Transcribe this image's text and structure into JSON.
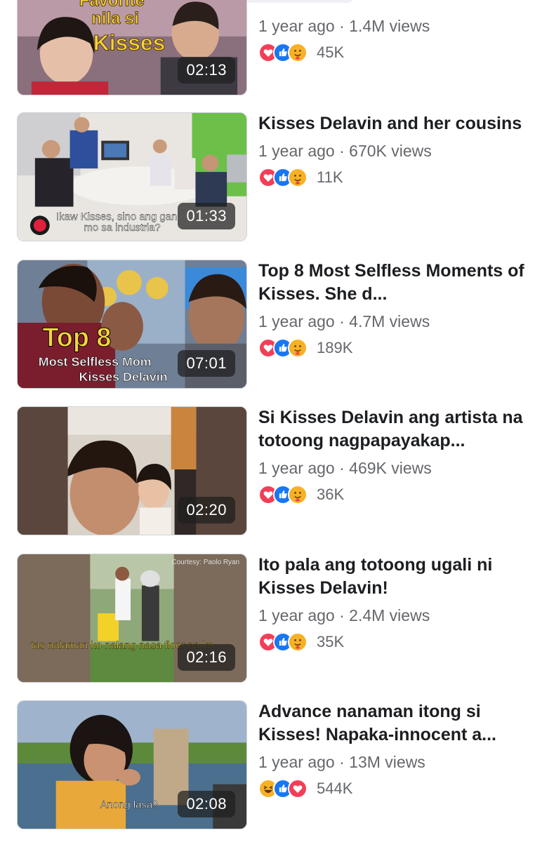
{
  "videos": [
    {
      "title": "",
      "age": "1 year ago",
      "views": "1.4M views",
      "reaction_count": "45K",
      "duration": "02:13",
      "reactions": [
        "love",
        "like",
        "care"
      ],
      "thumb_text": [
        "Favorite",
        "nila si",
        "Kisses"
      ]
    },
    {
      "title": "Kisses Delavin and her cousins",
      "age": "1 year ago",
      "views": "670K views",
      "reaction_count": "11K",
      "duration": "01:33",
      "reactions": [
        "love",
        "like",
        "care"
      ],
      "thumb_text": [
        "Ikaw Kisses, sino ang gan",
        "mo sa industria?"
      ]
    },
    {
      "title": "Top 8 Most Selfless Moments of Kisses. She d...",
      "age": "1 year ago",
      "views": "4.7M views",
      "reaction_count": "189K",
      "duration": "07:01",
      "reactions": [
        "love",
        "like",
        "care"
      ],
      "thumb_text": [
        "Top 8",
        "Most Selfless Mom",
        "Kisses Delavin"
      ]
    },
    {
      "title": "Si Kisses Delavin ang artista na totoong nagpapayakap...",
      "age": "1 year ago",
      "views": "469K views",
      "reaction_count": "36K",
      "duration": "02:20",
      "reactions": [
        "love",
        "like",
        "care"
      ],
      "thumb_text": []
    },
    {
      "title": "Ito pala ang totoong ugali ni Kisses Delavin!",
      "age": "1 year ago",
      "views": "2.4M views",
      "reaction_count": "35K",
      "duration": "02:16",
      "reactions": [
        "love",
        "like",
        "care"
      ],
      "thumb_text": [
        "tas nalaman ko nalang nasa floor na ko",
        "Courtesy: Paolo Ryan"
      ]
    },
    {
      "title": "Advance nanaman itong si Kisses! Napaka-innocent a...",
      "age": "1 year ago",
      "views": "13M views",
      "reaction_count": "544K",
      "duration": "02:08",
      "reactions": [
        "haha",
        "like",
        "love"
      ],
      "thumb_text": [
        "Anong lasa?"
      ]
    }
  ],
  "separator": " · ",
  "colors": {
    "love": "#f33e58",
    "like": "#1877f2",
    "care": "#f7b125",
    "haha": "#f7b125",
    "text_secondary": "#65676b",
    "text_primary": "#1c1e21"
  }
}
